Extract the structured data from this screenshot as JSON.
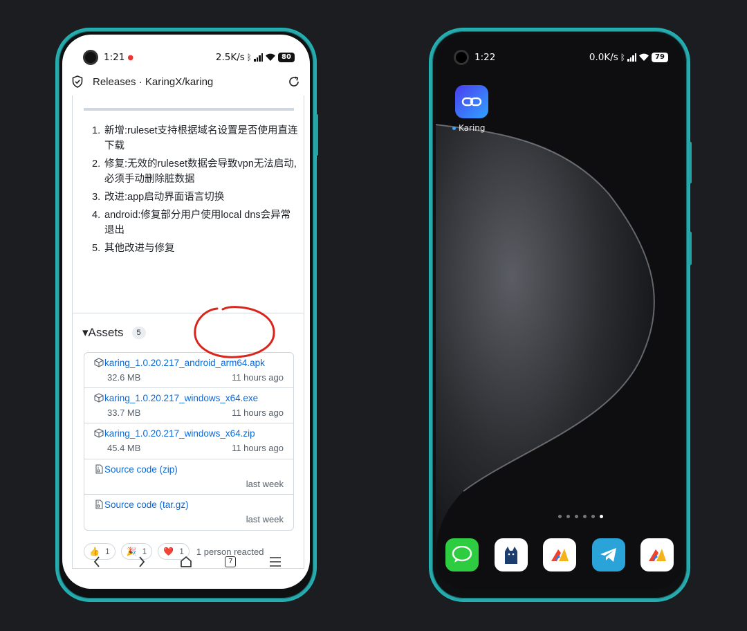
{
  "left_phone": {
    "status": {
      "time": "1:21",
      "speed": "2.5K/s",
      "battery": "80"
    },
    "urlbar": {
      "title": "Releases · KaringX/karing"
    },
    "release_notes": [
      {
        "num": "1.",
        "text": "新增:ruleset支持根据域名设置是否使用直连下载"
      },
      {
        "num": "2.",
        "text": "修复:无效的ruleset数据会导致vpn无法启动,必须手动删除脏数据"
      },
      {
        "num": "3.",
        "text": "改进:app启动界面语言切换"
      },
      {
        "num": "4.",
        "text": "android:修复部分用户使用local dns会异常退出"
      },
      {
        "num": "5.",
        "text": "其他改进与修复"
      }
    ],
    "assets": {
      "heading": "▾Assets",
      "count": "5",
      "items": [
        {
          "name": "karing_1.0.20.217_android_arm64.apk",
          "size": "32.6 MB",
          "when": "11 hours ago",
          "icon": "package-icon"
        },
        {
          "name": "karing_1.0.20.217_windows_x64.exe",
          "size": "33.7 MB",
          "when": "11 hours ago",
          "icon": "package-icon"
        },
        {
          "name": "karing_1.0.20.217_windows_x64.zip",
          "size": "45.4 MB",
          "when": "11 hours ago",
          "icon": "package-icon"
        },
        {
          "name": "Source code (zip)",
          "size": "",
          "when": "last week",
          "icon": "file-zip-icon"
        },
        {
          "name": "Source code (tar.gz)",
          "size": "",
          "when": "last week",
          "icon": "file-zip-icon"
        }
      ]
    },
    "reactions": {
      "items": [
        {
          "emoji": "👍",
          "count": "1"
        },
        {
          "emoji": "🎉",
          "count": "1"
        },
        {
          "emoji": "❤️",
          "count": "1"
        }
      ],
      "summary": "1 person reacted"
    },
    "nav": {
      "tabs_count": "7"
    }
  },
  "right_phone": {
    "status": {
      "time": "1:22",
      "speed": "0.0K/s",
      "battery": "79"
    },
    "home_app": {
      "label": "Karing"
    },
    "dock_apps": [
      "messages-app-icon",
      "cat-app-icon",
      "arrow-app-icon",
      "telegram-app-icon",
      "arrow-app-icon-2"
    ]
  },
  "colors": {
    "accent_link": "#0969da",
    "frame": "#2aa6a8",
    "annotation": "#d9261c"
  }
}
